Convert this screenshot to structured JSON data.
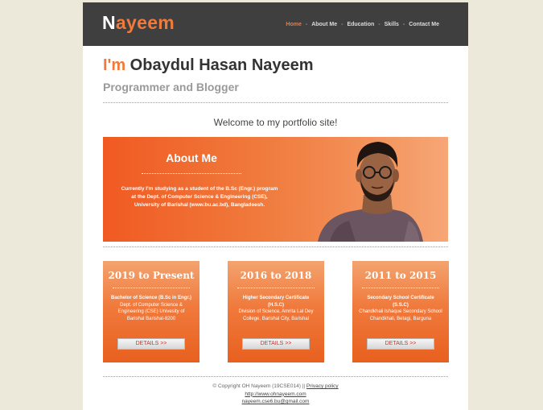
{
  "brand": {
    "first_letter": "N",
    "rest": "ayeem"
  },
  "nav": {
    "items": [
      {
        "label": "Home",
        "active": true
      },
      {
        "label": "About Me",
        "active": false
      },
      {
        "label": "Education",
        "active": false
      },
      {
        "label": "Skills",
        "active": false
      },
      {
        "label": "Contact Me",
        "active": false
      }
    ],
    "separator": "-"
  },
  "hero": {
    "im": "I'm",
    "name": "Obaydul Hasan Nayeem",
    "subtitle": "Programmer and Blogger"
  },
  "welcome": "Welcome to my portfolio site!",
  "about": {
    "title": "About Me",
    "text": "Currently I'm studying as a student of the B.Sc (Engr.) program at the Dept. of Computer Science & Engineering (CSE), University of Barishal (www.bu.ac.bd), Bangladeesh."
  },
  "education": [
    {
      "years": "2019 to Present",
      "degree": "Bachelor of Science (B.Sc in Engr.)",
      "details": "Dept. of Computer Science & Engineering (CSE) Univesity of Barishal Barishal-8200",
      "button": "DETAILS >>"
    },
    {
      "years": "2016 to 2018",
      "degree": "Higher Secondary Certificate (H.S.C)",
      "details": "Division of Science, Amrita Lal Dey College, Barishal City, Barishal",
      "button": "DETAILS >>"
    },
    {
      "years": "2011 to 2015",
      "degree": "Secondary School Certificate (S.S.C)",
      "details": "Chandkhali Ishaque Secondary School Chandkhali, Betagi, Barguna",
      "button": "DETAILS >>"
    }
  ],
  "footer": {
    "copyright": "© Copyright OH Nayeem (19CSE014) ||",
    "privacy": "Privacy policy",
    "website": "http://www.ohnayeem.com",
    "email": "nayeem.cse6.bu@gmail.com"
  },
  "colors": {
    "accent": "#f07a3c",
    "topbar": "#3f3f3f",
    "background": "#ece8da"
  }
}
